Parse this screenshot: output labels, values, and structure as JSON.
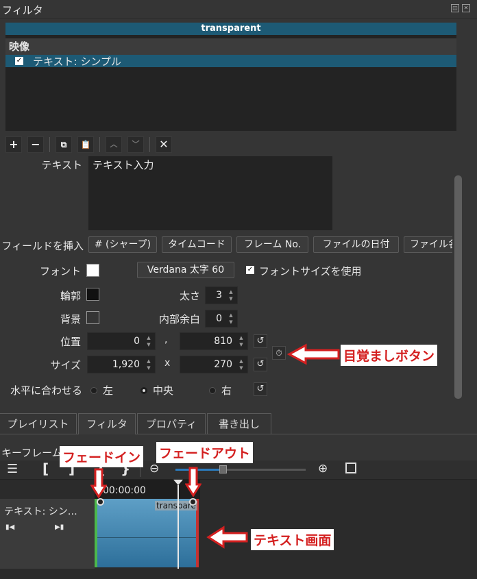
{
  "panel": {
    "title": "フィルタ",
    "float_icon": "◫",
    "close_icon": "✕"
  },
  "filter_list": {
    "header": "transparent",
    "category": "映像",
    "item_label": "テキスト: シンプル",
    "item_checked": "✓"
  },
  "toolbar": {
    "add": "+",
    "remove": "−",
    "copy": "⧉",
    "paste": "📋",
    "up": "︿",
    "down": "﹀",
    "deselect": "✕"
  },
  "text_section": {
    "label": "テキスト",
    "value": "テキスト入力"
  },
  "insert_field": {
    "label": "フィールドを挿入",
    "buttons": [
      "# (シャープ)",
      "タイムコード",
      "フレーム No.",
      "ファイルの日付",
      "ファイル名"
    ]
  },
  "font": {
    "label": "フォント",
    "button": "Verdana 太字 60",
    "use_size_label": "フォントサイズを使用",
    "checked": "✓"
  },
  "outline": {
    "label": "輪郭",
    "thickness_label": "太さ",
    "thickness_value": "3"
  },
  "background": {
    "label": "背景",
    "padding_label": "内部余白",
    "padding_value": "0"
  },
  "position": {
    "label": "位置",
    "x": "0",
    "sep": ",",
    "y": "810"
  },
  "size": {
    "label": "サイズ",
    "w": "1,920",
    "sep": "x",
    "h": "270"
  },
  "halign": {
    "label": "水平に合わせる",
    "options": [
      "左",
      "中央",
      "右"
    ],
    "selected": "中央"
  },
  "reset_icon": "↺",
  "keyframe_icon": "⏱",
  "tabs": [
    "プレイリスト",
    "フィルタ",
    "プロパティ",
    "書き出し"
  ],
  "keyframes": {
    "title": "キーフレーム",
    "timecode": "00:00:00",
    "track_label": "テキスト: シン…",
    "clip_label": "transpare"
  },
  "annotations": {
    "alarm": "目覚ましボタン",
    "fade_in": "フェードイン",
    "fade_out": "フェードアウト",
    "text_screen": "テキスト画面"
  },
  "colors": {
    "accent": "#1d5a75",
    "callout": "#d42020"
  }
}
